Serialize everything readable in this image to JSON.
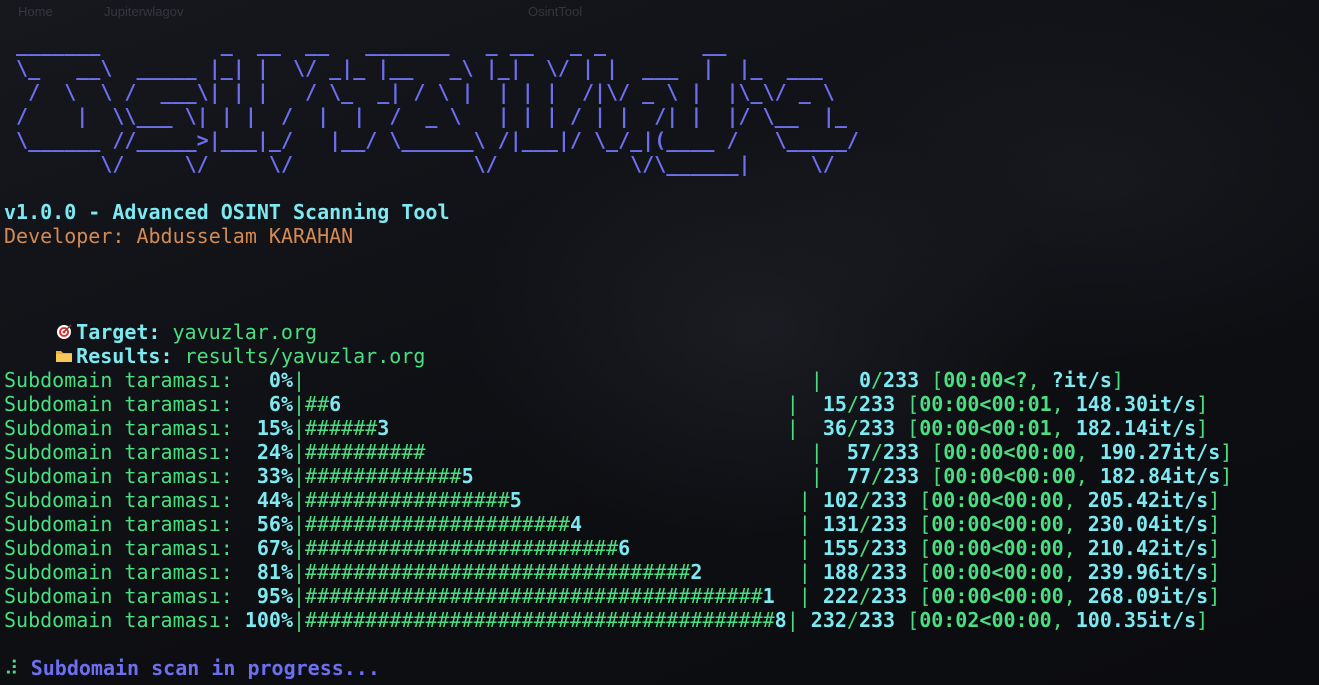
{
  "window": {
    "ghost_home": "Home",
    "ghost_user": "Jupiterwlagov",
    "ghost_app": "OsintTool"
  },
  "banner_lines": [
    " _______          _  __  __   _______   _ __   _ _        __",
    " \\_   __\\  _____ |_| |  \\/ _|_ |__   _\\ |_|  \\/ | |  ___  |  |_  ___",
    "  /  \\  \\ /  ___\\| | |   / \\_  _| / \\ |  | | |  /|\\/ _ \\ |  |\\_\\/ _ \\",
    " /    |  \\\\___ \\| | |  /  |  |  /  _ \\   | | | / | |  /| |  |/ \\__  |_",
    " \\______ //_____>|___|_/   |__/ \\______\\ /|___|/ \\_/_|(____ /   \\_____/",
    "        \\/     \\/     \\/               \\/           \\/\\______|     \\/"
  ],
  "version_line": "v1.0.0 - Advanced OSINT Scanning Tool",
  "developer_line": "Developer: Abdusselam KARAHAN",
  "target": {
    "label": "Target:",
    "value": "yavuzlar.org",
    "icon": "target-icon"
  },
  "results": {
    "label": "Results:",
    "value": "results/yavuzlar.org",
    "icon": "folder-icon"
  },
  "progress": [
    {
      "label": "Subdomain taraması:",
      "pct": "  0%",
      "bar": "",
      "tail": "",
      "gap": "                                          ",
      "cur": "  0",
      "total": "233",
      "elapsed": "00:00",
      "remain": "<?",
      "rate_int": " ?",
      "rate_frac": "it/s"
    },
    {
      "label": "Subdomain taraması:",
      "pct": "  6%",
      "bar": "##",
      "tail": "6",
      "gap": "                                     ",
      "cur": " 15",
      "total": "233",
      "elapsed": "00:00",
      "remain": "<00:01",
      "rate_int": " 148.",
      "rate_frac": "30it/s"
    },
    {
      "label": "Subdomain taraması:",
      "pct": " 15%",
      "bar": "######",
      "tail": "3",
      "gap": "                                 ",
      "cur": " 36",
      "total": "233",
      "elapsed": "00:00",
      "remain": "<00:01",
      "rate_int": " 182.",
      "rate_frac": "14it/s"
    },
    {
      "label": "Subdomain taraması:",
      "pct": " 24%",
      "bar": "##########",
      "tail": "",
      "gap": "                                ",
      "cur": " 57",
      "total": "233",
      "elapsed": "00:00",
      "remain": "<00:00",
      "rate_int": " 190.",
      "rate_frac": "27it/s"
    },
    {
      "label": "Subdomain taraması:",
      "pct": " 33%",
      "bar": "#############",
      "tail": "5",
      "gap": "                            ",
      "cur": " 77",
      "total": "233",
      "elapsed": "00:00",
      "remain": "<00:00",
      "rate_int": " 182.",
      "rate_frac": "84it/s"
    },
    {
      "label": "Subdomain taraması:",
      "pct": " 44%",
      "bar": "#################",
      "tail": "5",
      "gap": "                       ",
      "cur": "102",
      "total": "233",
      "elapsed": "00:00",
      "remain": "<00:00",
      "rate_int": " 205.",
      "rate_frac": "42it/s"
    },
    {
      "label": "Subdomain taraması:",
      "pct": " 56%",
      "bar": "######################",
      "tail": "4",
      "gap": "                  ",
      "cur": "131",
      "total": "233",
      "elapsed": "00:00",
      "remain": "<00:00",
      "rate_int": " 230.",
      "rate_frac": "04it/s"
    },
    {
      "label": "Subdomain taraması:",
      "pct": " 67%",
      "bar": "##########################",
      "tail": "6",
      "gap": "              ",
      "cur": "155",
      "total": "233",
      "elapsed": "00:00",
      "remain": "<00:00",
      "rate_int": " 210.",
      "rate_frac": "42it/s"
    },
    {
      "label": "Subdomain taraması:",
      "pct": " 81%",
      "bar": "################################",
      "tail": "2",
      "gap": "        ",
      "cur": "188",
      "total": "233",
      "elapsed": "00:00",
      "remain": "<00:00",
      "rate_int": " 239.",
      "rate_frac": "96it/s"
    },
    {
      "label": "Subdomain taraması:",
      "pct": " 95%",
      "bar": "######################################",
      "tail": "1",
      "gap": "  ",
      "cur": "222",
      "total": "233",
      "elapsed": "00:00",
      "remain": "<00:00",
      "rate_int": " 268.",
      "rate_frac": "09it/s"
    },
    {
      "label": "Subdomain taraması:",
      "pct": "100%",
      "bar": "#######################################",
      "tail": "8",
      "gap": "",
      "cur": "232",
      "total": "233",
      "elapsed": "00:02",
      "remain": "<00:00",
      "rate_int": " 100.",
      "rate_frac": "35it/s"
    }
  ],
  "status": {
    "spinner": "⠼",
    "text": "Subdomain scan in progress..."
  },
  "colors": {
    "background": "#0d0e12",
    "banner": "#6d6ff0",
    "cyan": "#7ee9f0",
    "green": "#4ade80",
    "developer": "#d38a55"
  }
}
